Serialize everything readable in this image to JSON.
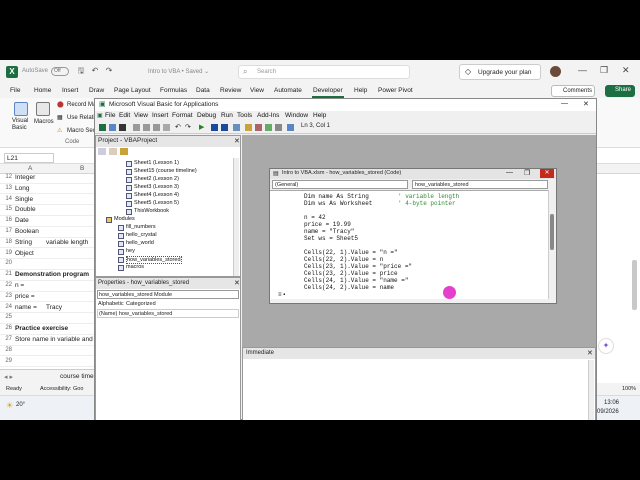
{
  "excel": {
    "autosave": "AutoSave",
    "toggle": "Off",
    "file_name": "Intro to VBA • Saved ⌄",
    "search_placeholder": "Search",
    "upgrade": "Upgrade your plan",
    "menu": [
      "File",
      "Home",
      "Insert",
      "Draw",
      "Page Layout",
      "Formulas",
      "Data",
      "Review",
      "View",
      "Automate",
      "Developer",
      "Help",
      "Power Pivot"
    ],
    "comments": "Comments",
    "share": "Share",
    "ribbon": {
      "visual_basic": "Visual Basic",
      "macros": "Macros",
      "record": "Record Ma",
      "relative": "Use Relativ",
      "security": "Macro Secu",
      "group": "Code"
    },
    "name_box": "L21",
    "columns": [
      "A",
      "B"
    ],
    "rows": [
      {
        "n": "12",
        "a": "Integer",
        "b": ""
      },
      {
        "n": "13",
        "a": "Long",
        "b": ""
      },
      {
        "n": "14",
        "a": "Single",
        "b": ""
      },
      {
        "n": "15",
        "a": "Double",
        "b": ""
      },
      {
        "n": "16",
        "a": "Date",
        "b": ""
      },
      {
        "n": "17",
        "a": "Boolean",
        "b": ""
      },
      {
        "n": "18",
        "a": "String",
        "b": "variable length"
      },
      {
        "n": "19",
        "a": "Object",
        "b": ""
      },
      {
        "n": "20",
        "a": "",
        "b": ""
      },
      {
        "n": "21",
        "a": "Demonstration program",
        "b": ""
      },
      {
        "n": "22",
        "a": "n =",
        "b": ""
      },
      {
        "n": "23",
        "a": "price =",
        "b": ""
      },
      {
        "n": "24",
        "a": "name =",
        "b": "Tracy"
      },
      {
        "n": "25",
        "a": "",
        "b": ""
      },
      {
        "n": "26",
        "a": "Practice exercise",
        "b": ""
      },
      {
        "n": "27",
        "a": "Store name in variable and c",
        "b": ""
      },
      {
        "n": "28",
        "a": "",
        "b": ""
      },
      {
        "n": "29",
        "a": "",
        "b": ""
      }
    ],
    "sheet_tab": "course time",
    "status_ready": "Ready",
    "accessibility": "Accessibility: Goo",
    "zoom": "100%",
    "weather": "20°",
    "time": "13:06",
    "date": "09/2026"
  },
  "vbe": {
    "title": "Microsoft Visual Basic for Applications",
    "menu": [
      "File",
      "Edit",
      "View",
      "Insert",
      "Format",
      "Debug",
      "Run",
      "Tools",
      "Add-Ins",
      "Window",
      "Help"
    ],
    "position": "Ln 3, Col 1",
    "project_title": "Project - VBAProject",
    "tree": [
      "Sheet1 (Lesson 1)",
      "Sheet15 (course timeline)",
      "Sheet2 (Lesson 2)",
      "Sheet3 (Lesson 3)",
      "Sheet4 (Lesson 4)",
      "Sheet5 (Lesson 5)",
      "ThisWorkbook",
      "Modules",
      "fill_numbers",
      "hello_crystal",
      "hello_world",
      "hey",
      "how_variables_stored",
      "macros"
    ],
    "properties_title": "Properties - how_variables_stored",
    "properties_object": "how_variables_stored Module",
    "tabs": [
      "Alphabetic",
      "Categorized"
    ],
    "prop_row": "(Name)  how_variables_stored",
    "immediate_title": "Immediate",
    "code_title": "Intro to VBA.xlsm - how_variables_stored (Code)",
    "dropdown_left": "(General)",
    "dropdown_right": "how_variables_stored",
    "code_lines": [
      {
        "code": "Dim name As String",
        "comment": "' variable length"
      },
      {
        "code": "Dim ws As Worksheet",
        "comment": "' 4-byte pointer"
      },
      {
        "code": "",
        "comment": ""
      },
      {
        "code": "n = 42",
        "comment": ""
      },
      {
        "code": "price = 19.99",
        "comment": ""
      },
      {
        "code": "name = \"Tracy\"",
        "comment": ""
      },
      {
        "code": "Set ws = Sheet5",
        "comment": ""
      },
      {
        "code": "",
        "comment": ""
      },
      {
        "code": "Cells(22, 1).Value = \"n =\"",
        "comment": ""
      },
      {
        "code": "Cells(22, 2).Value = n",
        "comment": ""
      },
      {
        "code": "Cells(23, 1).Value = \"price =\"",
        "comment": ""
      },
      {
        "code": "Cells(23, 2).Value = price",
        "comment": ""
      },
      {
        "code": "Cells(24, 1).Value = \"name =\"",
        "comment": ""
      },
      {
        "code": "Cells(24, 2).Value = name",
        "comment": ""
      }
    ]
  }
}
